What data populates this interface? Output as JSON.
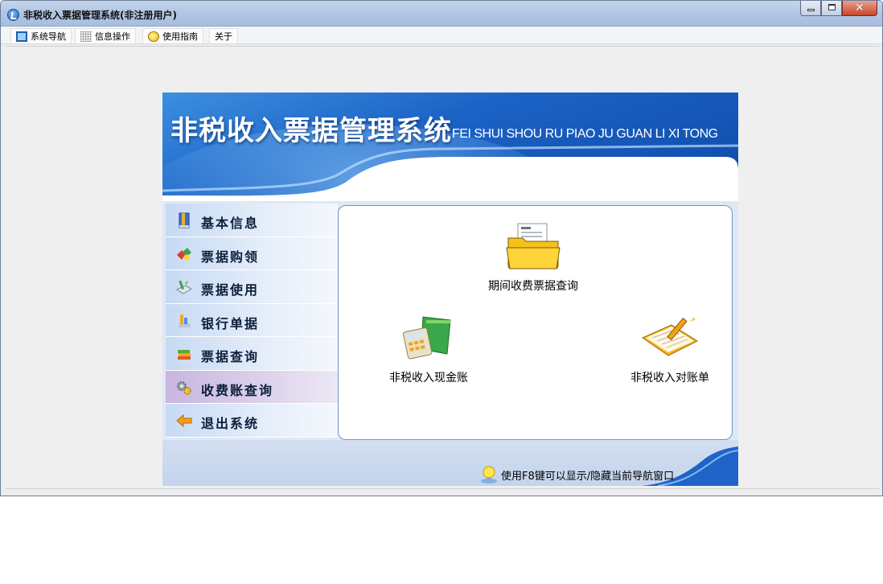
{
  "window": {
    "title": "非税收入票据管理系统(非注册用户)"
  },
  "menu": [
    {
      "label": "系统导航",
      "icon": "monitor-icon"
    },
    {
      "label": "信息操作",
      "icon": "grid-icon"
    },
    {
      "label": "使用指南",
      "icon": "help-bulb-icon"
    },
    {
      "label": "关于",
      "icon": ""
    }
  ],
  "banner": {
    "title": "非税收入票据管理系统",
    "pinyin": "FEI SHUI SHOU RU PIAO JU GUAN LI XI TONG"
  },
  "sidebar": {
    "items": [
      {
        "label": "基本信息",
        "icon": "book-icon"
      },
      {
        "label": "票据购领",
        "icon": "gems-icon"
      },
      {
        "label": "票据使用",
        "icon": "document-pen-icon"
      },
      {
        "label": "银行单据",
        "icon": "bank-bill-icon"
      },
      {
        "label": "票据查询",
        "icon": "books-stack-icon"
      },
      {
        "label": "收费账查询",
        "icon": "gears-icon",
        "active": true
      },
      {
        "label": "退出系统",
        "icon": "arrow-left-icon"
      }
    ]
  },
  "functions": [
    {
      "label": "期间收费票据查询",
      "icon": "folder-files-icon"
    },
    {
      "label": "非税收入现金账",
      "icon": "calculator-book-icon"
    },
    {
      "label": "非税收入对账单",
      "icon": "notebook-pen-icon"
    }
  ],
  "footer": {
    "tip": "使用F8键可以显示/隐藏当前导航窗口"
  },
  "colors": {
    "banner_blue": "#1c63c6",
    "sidebar_active": "#c9b5e0",
    "content_border": "#6f93c7"
  }
}
